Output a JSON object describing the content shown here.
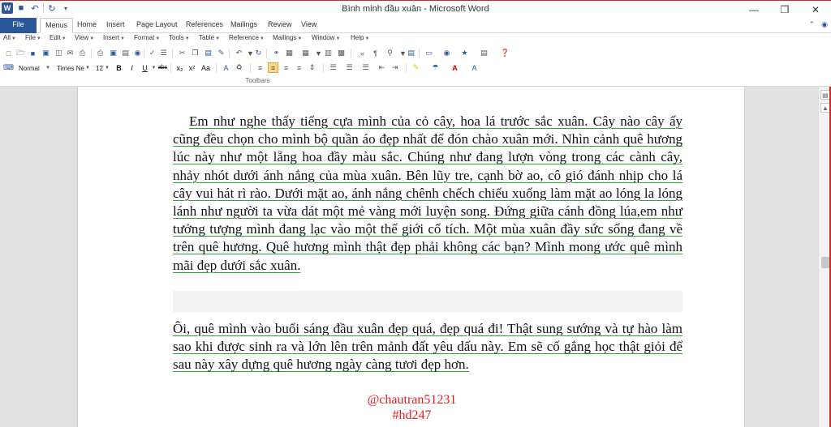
{
  "window": {
    "title": "Bình minh đầu xuân - Microsoft Word",
    "app_icon": "W",
    "controls": [
      "minimize-icon",
      "restore-icon",
      "close-icon"
    ]
  },
  "ribbon": {
    "tabs": [
      "File",
      "Menus",
      "Home",
      "Insert",
      "Page Layout",
      "References",
      "Mailings",
      "Review",
      "View"
    ],
    "active_tab": "Menus"
  },
  "menubar": {
    "items": [
      "All",
      "File",
      "Edit",
      "View",
      "Insert",
      "Format",
      "Tools",
      "Table",
      "Reference",
      "Mailings",
      "Window",
      "Help"
    ]
  },
  "toolbar": {
    "style_value": "Normal",
    "font_value": "Times Ne",
    "size_value": "12",
    "bold_label": "B",
    "italic_label": "I",
    "underline_label": "U",
    "strike_label": "abc",
    "group_label": "Toolbars"
  },
  "document": {
    "paragraph1": "Em như nghe thấy tiếng cựa mình của cỏ cây, hoa lá trước sắc xuân. Cây nào cây ấy cũng đều chọn cho mình bộ quần áo đẹp nhất để đón chào xuân mới. Nhìn cảnh quê hương lúc này như một lẵng hoa đầy màu sắc. Chúng như đang lượn vòng trong các cành cây, nhảy nhót dưới ánh nắng của mùa xuân. Bên lũy tre, cạnh bờ ao, cô gió đánh nhịp cho lá cây vui hát rì rào. Dưới mặt ao, ánh nắng chênh chếch chiếu xuống làm mặt ao lóng la lóng lánh như người ta vừa dát một mẻ vàng mới luyện song. Đứng giữa cánh đồng lúa,em như tưởng tượng mình đang lạc vào một thế giới cổ tích. Một mùa xuân đầy sức sống đang về trên quê hương. Quê hương mình thật đẹp phải không các bạn? Mình mong ước quê mình mãi đẹp dưới sắc xuân.",
    "paragraph2": "Ôi, quê mình vào buổi sáng đầu xuân đẹp quá, đẹp quá đi! Thật sung sướng và tự hào làm sao khi được sinh ra và lớn lên trên mảnh đất yêu dấu này. Em sẽ cố gắng học thật giỏi để sau này xây dựng quê hương ngày càng tươi đẹp hơn.",
    "signature_line1": "@chautran51231",
    "signature_line2": "#hd247"
  },
  "colors": {
    "accent": "#2b579a",
    "grammar_underline": "#2cab2c",
    "signature": "#e02020"
  }
}
